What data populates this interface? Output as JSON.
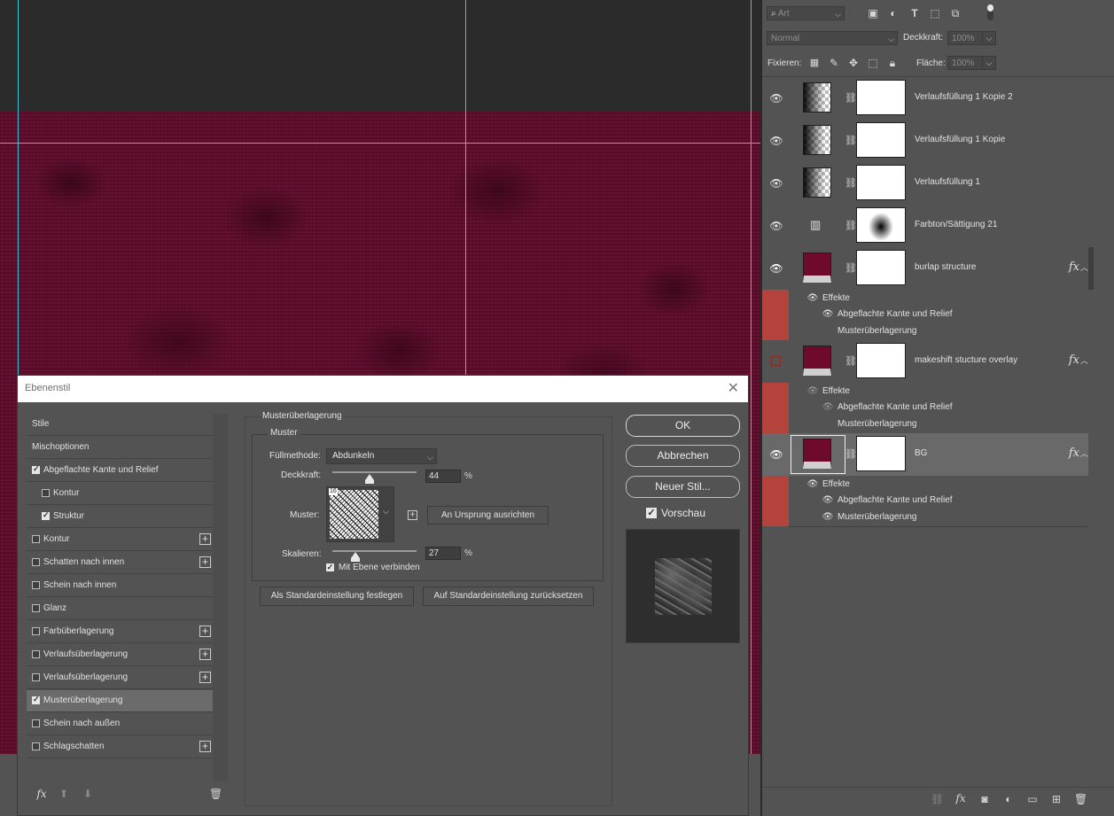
{
  "layers_panel": {
    "filter_value": "Art",
    "blend_mode": "Normal",
    "opacity_label": "Deckkraft:",
    "opacity_value": "100%",
    "lock_label": "Fixieren:",
    "fill_label": "Fläche:",
    "fill_value": "100%",
    "layers": [
      {
        "name": "Verlaufsfüllung 1 Kopie 2"
      },
      {
        "name": "Verlaufsfüllung 1 Kopie"
      },
      {
        "name": "Verlaufsfüllung 1"
      },
      {
        "name": "Farbton/Sättigung 21"
      },
      {
        "name": "burlap structure",
        "fx": "fx",
        "effects_label": "Effekte",
        "effects": [
          "Abgeflachte Kante und Relief",
          "Musterüberlagerung"
        ]
      },
      {
        "name": "makeshift stucture overlay",
        "fx": "fx",
        "effects_label": "Effekte",
        "effects": [
          "Abgeflachte Kante und Relief",
          "Musterüberlagerung"
        ]
      },
      {
        "name": "BG",
        "fx": "fx",
        "effects_label": "Effekte",
        "effects": [
          "Abgeflachte Kante und Relief",
          "Musterüberlagerung"
        ]
      }
    ]
  },
  "dialog": {
    "title": "Ebenenstil",
    "styles": [
      {
        "label": "Stile",
        "checkbox": false,
        "plus": false
      },
      {
        "label": "Mischoptionen",
        "checkbox": false,
        "plus": false
      },
      {
        "label": "Abgeflachte Kante und Relief",
        "checkbox": true,
        "checked": true,
        "plus": false
      },
      {
        "label": "Kontur",
        "checkbox": true,
        "checked": false,
        "plus": false,
        "indent": true
      },
      {
        "label": "Struktur",
        "checkbox": true,
        "checked": true,
        "plus": false,
        "indent": true
      },
      {
        "label": "Kontur",
        "checkbox": true,
        "checked": false,
        "plus": true
      },
      {
        "label": "Schatten nach innen",
        "checkbox": true,
        "checked": false,
        "plus": true
      },
      {
        "label": "Schein nach innen",
        "checkbox": true,
        "checked": false,
        "plus": false
      },
      {
        "label": "Glanz",
        "checkbox": true,
        "checked": false,
        "plus": false
      },
      {
        "label": "Farbüberlagerung",
        "checkbox": true,
        "checked": false,
        "plus": true
      },
      {
        "label": "Verlaufsüberlagerung",
        "checkbox": true,
        "checked": false,
        "plus": true
      },
      {
        "label": "Verlaufsüberlagerung",
        "checkbox": true,
        "checked": false,
        "plus": true
      },
      {
        "label": "Musterüberlagerung",
        "checkbox": true,
        "checked": true,
        "plus": false,
        "selected": true
      },
      {
        "label": "Schein nach außen",
        "checkbox": true,
        "checked": false,
        "plus": false
      },
      {
        "label": "Schlagschatten",
        "checkbox": true,
        "checked": false,
        "plus": true
      }
    ],
    "section_title": "Musterüberlagerung",
    "group_title": "Muster",
    "fill_method_label": "Füllmethode:",
    "fill_method_value": "Abdunkeln",
    "opacity_label": "Deckkraft:",
    "opacity_value": "44",
    "opacity_fraction": 0.44,
    "percent": "%",
    "pattern_label": "Muster:",
    "pattern_badge": "16",
    "snap_origin_label": "An Ursprung ausrichten",
    "scale_label": "Skalieren:",
    "scale_value": "27",
    "scale_fraction": 0.27,
    "link_layer_label": "Mit Ebene verbinden",
    "make_default_label": "Als Standardeinstellung festlegen",
    "reset_default_label": "Auf Standardeinstellung zurücksetzen",
    "ok_label": "OK",
    "cancel_label": "Abbrechen",
    "new_style_label": "Neuer Stil...",
    "preview_label": "Vorschau"
  }
}
